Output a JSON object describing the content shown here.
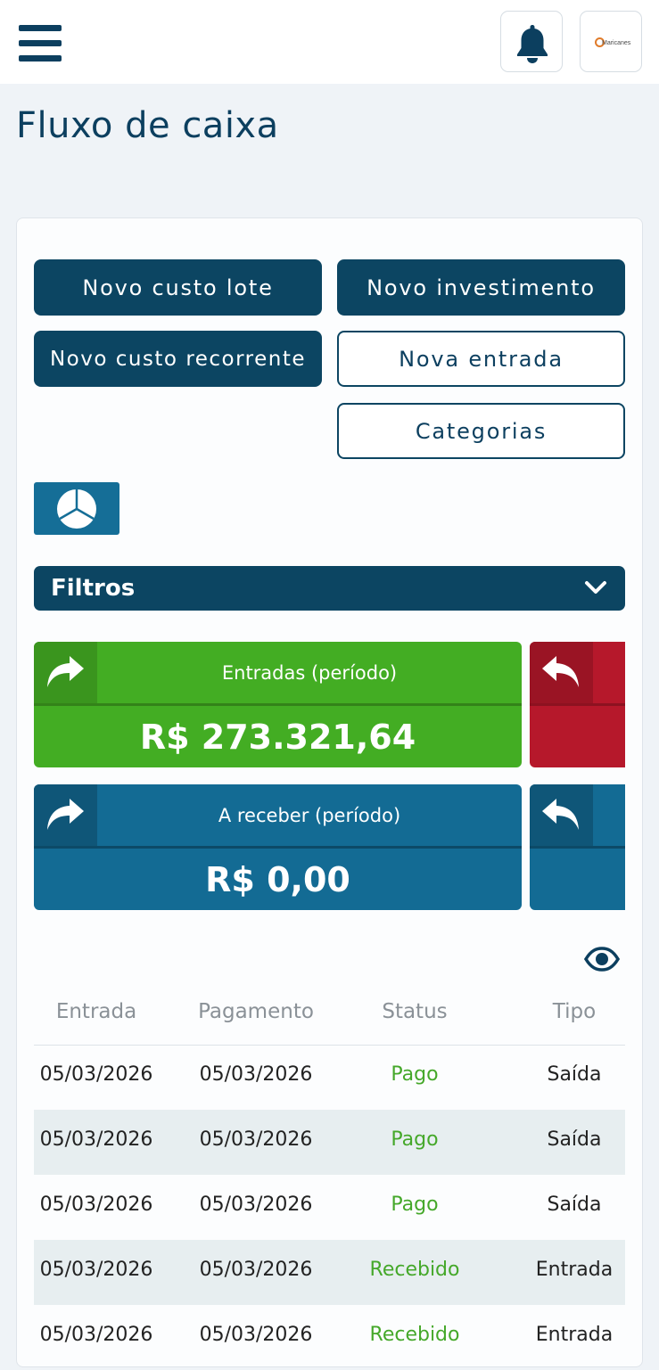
{
  "header": {
    "menu_icon": "hamburger-menu-icon",
    "notifications_icon": "bell-icon",
    "logo_text": "Maricanes"
  },
  "page": {
    "title": "Fluxo de caixa"
  },
  "actions": {
    "novo_custo_lote": "Novo custo lote",
    "novo_investimento": "Novo investimento",
    "novo_custo_recorrente": "Novo custo recorrente",
    "nova_entrada": "Nova entrada",
    "categorias": "Categorias",
    "chart_icon": "pie-chart-icon"
  },
  "filters": {
    "label": "Filtros",
    "icon": "chevron-down-icon"
  },
  "stats": [
    {
      "label": "Entradas (período)",
      "value": "R$ 273.321,64",
      "color": "#43ad23"
    },
    {
      "label": "",
      "value": "",
      "color": "#b6182b"
    },
    {
      "label": "A receber (período)",
      "value": "R$ 0,00",
      "color": "#136b94"
    },
    {
      "label": "",
      "value": "",
      "color": "#136b94"
    }
  ],
  "table": {
    "toggle_icon": "eye-icon",
    "columns": [
      "Entrada",
      "Pagamento",
      "Status",
      "Tipo"
    ],
    "rows": [
      [
        "05/03/2026",
        "05/03/2026",
        "Pago",
        "Saída"
      ],
      [
        "05/03/2026",
        "05/03/2026",
        "Pago",
        "Saída"
      ],
      [
        "05/03/2026",
        "05/03/2026",
        "Pago",
        "Saída"
      ],
      [
        "05/03/2026",
        "05/03/2026",
        "Recebido",
        "Entrada"
      ],
      [
        "05/03/2026",
        "05/03/2026",
        "Recebido",
        "Entrada"
      ]
    ]
  },
  "colors": {
    "primary": "#0c4562",
    "success": "#43ad23",
    "danger": "#b6182b",
    "info": "#136b94",
    "status_text": "#45a82a"
  }
}
